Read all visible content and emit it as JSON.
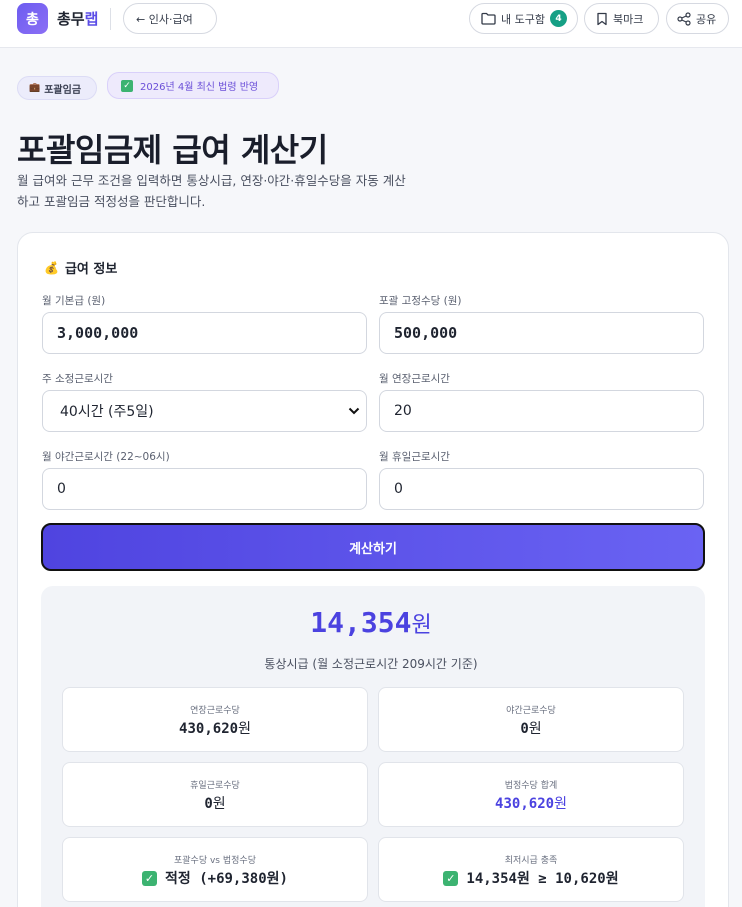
{
  "header": {
    "logo_char": "총",
    "brand_main": "총무",
    "brand_accent": "랩",
    "back_label": "← 인사·급여",
    "toolbox_label": "내 도구함",
    "toolbox_count": "4",
    "bookmark_label": "북마크",
    "share_label": "공유"
  },
  "tags": {
    "category": "포괄임금",
    "law": "2026년 4월 최신 법령 반영"
  },
  "page": {
    "title": "포괄임금제 급여 계산기",
    "description": "월 급여와 근무 조건을 입력하면 통상시급, 연장·야간·휴일수당을 자동 계산하고 포괄임금 적정성을 판단합니다."
  },
  "form": {
    "section_title": "급여 정보",
    "base_pay_label": "월 기본급 (원)",
    "base_pay_value": "3,000,000",
    "fixed_allowance_label": "포괄 고정수당 (원)",
    "fixed_allowance_value": "500,000",
    "weekly_hours_label": "주 소정근로시간",
    "weekly_hours_value": "40시간 (주5일)",
    "overtime_label": "월 연장근로시간",
    "overtime_value": "20",
    "night_label": "월 야간근로시간 (22~06시)",
    "night_value": "0",
    "holiday_label": "월 휴일근로시간",
    "holiday_value": "0",
    "calc_button": "계산하기"
  },
  "result": {
    "hourly_value": "14,354",
    "hourly_unit": "원",
    "hourly_caption": "통상시급 (월 소정근로시간 209시간 기준)",
    "boxes": [
      {
        "label": "연장근로수당",
        "value": "430,620",
        "unit": "원"
      },
      {
        "label": "야간근로수당",
        "value": "0",
        "unit": "원"
      },
      {
        "label": "휴일근로수당",
        "value": "0",
        "unit": "원"
      },
      {
        "label": "법정수당 합계",
        "value": "430,620",
        "unit": "원"
      },
      {
        "label": "포괄수당 vs 법정수당",
        "value": "적정 (+69,380원)"
      },
      {
        "label": "최저시급 충족",
        "value": "14,354원 ≥ 10,620원"
      }
    ]
  },
  "colors": {
    "accent": "#4b42e0",
    "ok_green": "#3cb371",
    "badge_teal": "#16a085"
  }
}
